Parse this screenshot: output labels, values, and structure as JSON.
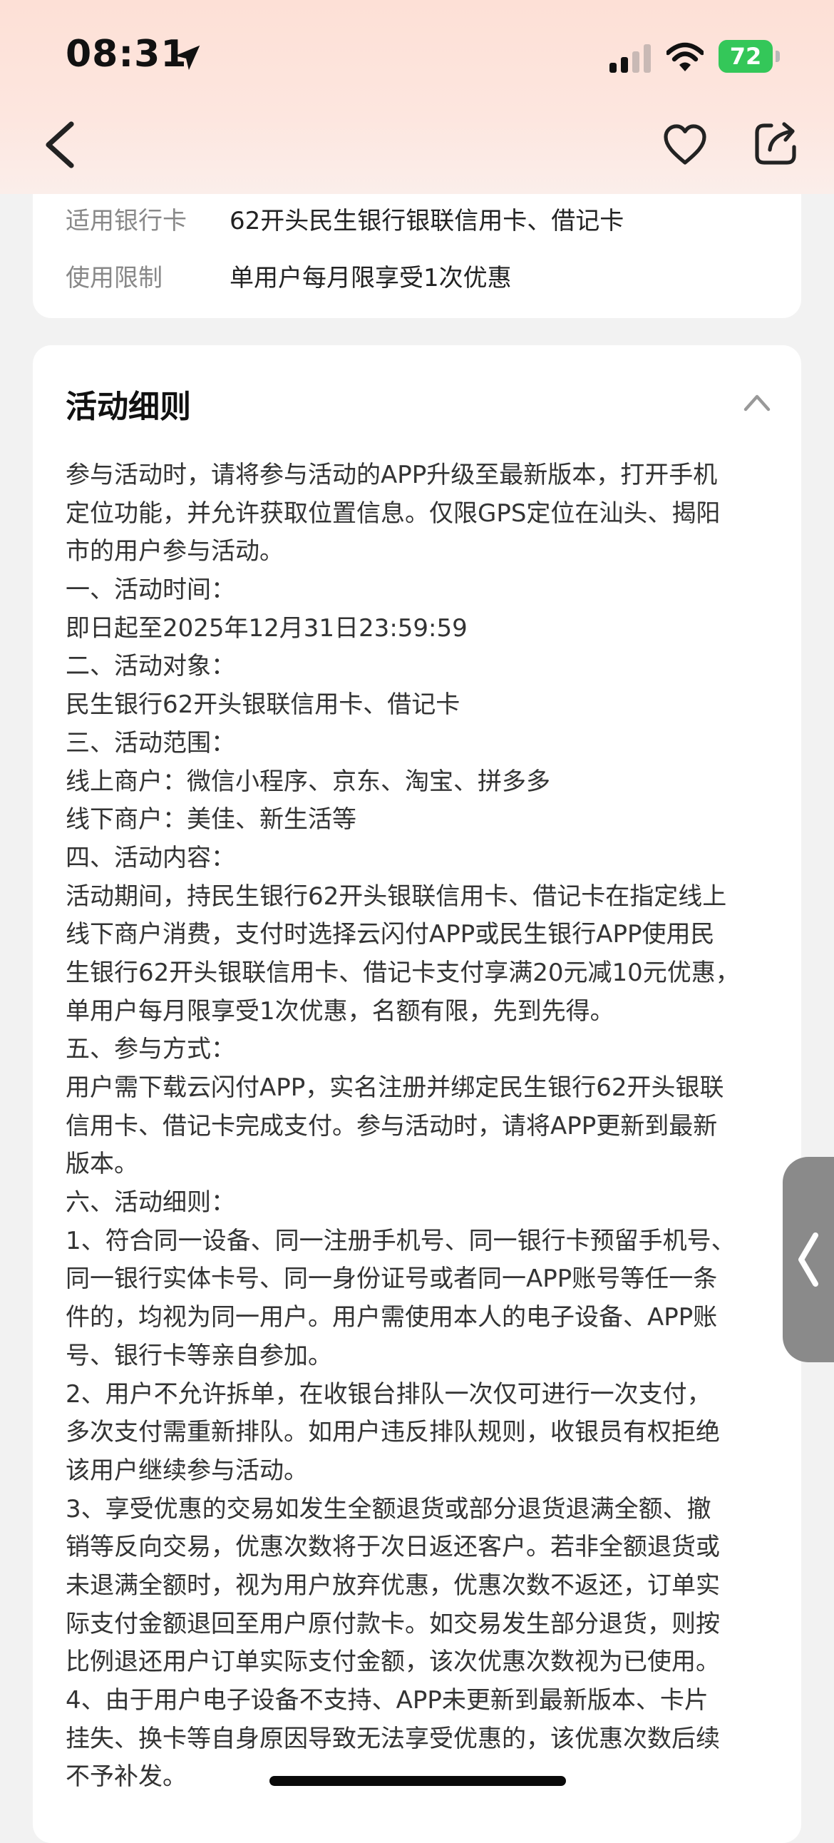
{
  "status_bar": {
    "time": "08:31",
    "battery": "72",
    "battery_color": "#34c759",
    "icons": [
      "location-arrow-icon",
      "signal-icon",
      "wifi-icon",
      "battery-icon"
    ]
  },
  "nav": {
    "icons": [
      "back-icon",
      "heart-icon",
      "share-icon"
    ]
  },
  "info": {
    "rows": [
      {
        "label": "适用银行卡",
        "value": "62开头民生银行银联信用卡、借记卡"
      },
      {
        "label": "使用限制",
        "value": "单用户每月限享受1次优惠"
      }
    ]
  },
  "rules": {
    "title": "活动细则",
    "lines": [
      "参与活动时，请将参与活动的APP升级至最新版本，打开手机",
      "定位功能，并允许获取位置信息。仅限GPS定位在汕头、揭阳",
      "市的用户参与活动。",
      "一、活动时间：",
      "即日起至2025年12月31日23:59:59",
      "二、活动对象：",
      "民生银行62开头银联信用卡、借记卡",
      "三、活动范围：",
      "线上商户：微信小程序、京东、淘宝、拼多多",
      "线下商户：美佳、新生活等",
      "四、活动内容：",
      "活动期间，持民生银行62开头银联信用卡、借记卡在指定线上",
      "线下商户消费，支付时选择云闪付APP或民生银行APP使用民",
      "生银行62开头银联信用卡、借记卡支付享满20元减10元优惠，",
      "单用户每月限享受1次优惠，名额有限，先到先得。",
      "五、参与方式：",
      "用户需下载云闪付APP，实名注册并绑定民生银行62开头银联",
      "信用卡、借记卡完成支付。参与活动时，请将APP更新到最新",
      "版本。",
      "六、活动细则：",
      "1、符合同一设备、同一注册手机号、同一银行卡预留手机号、",
      "同一银行实体卡号、同一身份证号或者同一APP账号等任一条",
      "件的，均视为同一用户。用户需使用本人的电子设备、APP账",
      "号、银行卡等亲自参加。",
      "2、用户不允许拆单，在收银台排队一次仅可进行一次支付，",
      "多次支付需重新排队。如用户违反排队规则，收银员有权拒绝",
      "该用户继续参与活动。",
      "3、享受优惠的交易如发生全额退货或部分退货退满全额、撤",
      "销等反向交易，优惠次数将于次日返还客户。若非全额退货或",
      "未退满全额时，视为用户放弃优惠，优惠次数不返还，订单实",
      "际支付金额退回至用户原付款卡。如交易发生部分退货，则按",
      "比例退还用户订单实际支付金额，该次优惠次数视为已使用。",
      "4、由于用户电子设备不支持、APP未更新到最新版本、卡片",
      "挂失、换卡等自身原因导致无法享受优惠的，该优惠次数后续",
      "不予补发。"
    ]
  }
}
